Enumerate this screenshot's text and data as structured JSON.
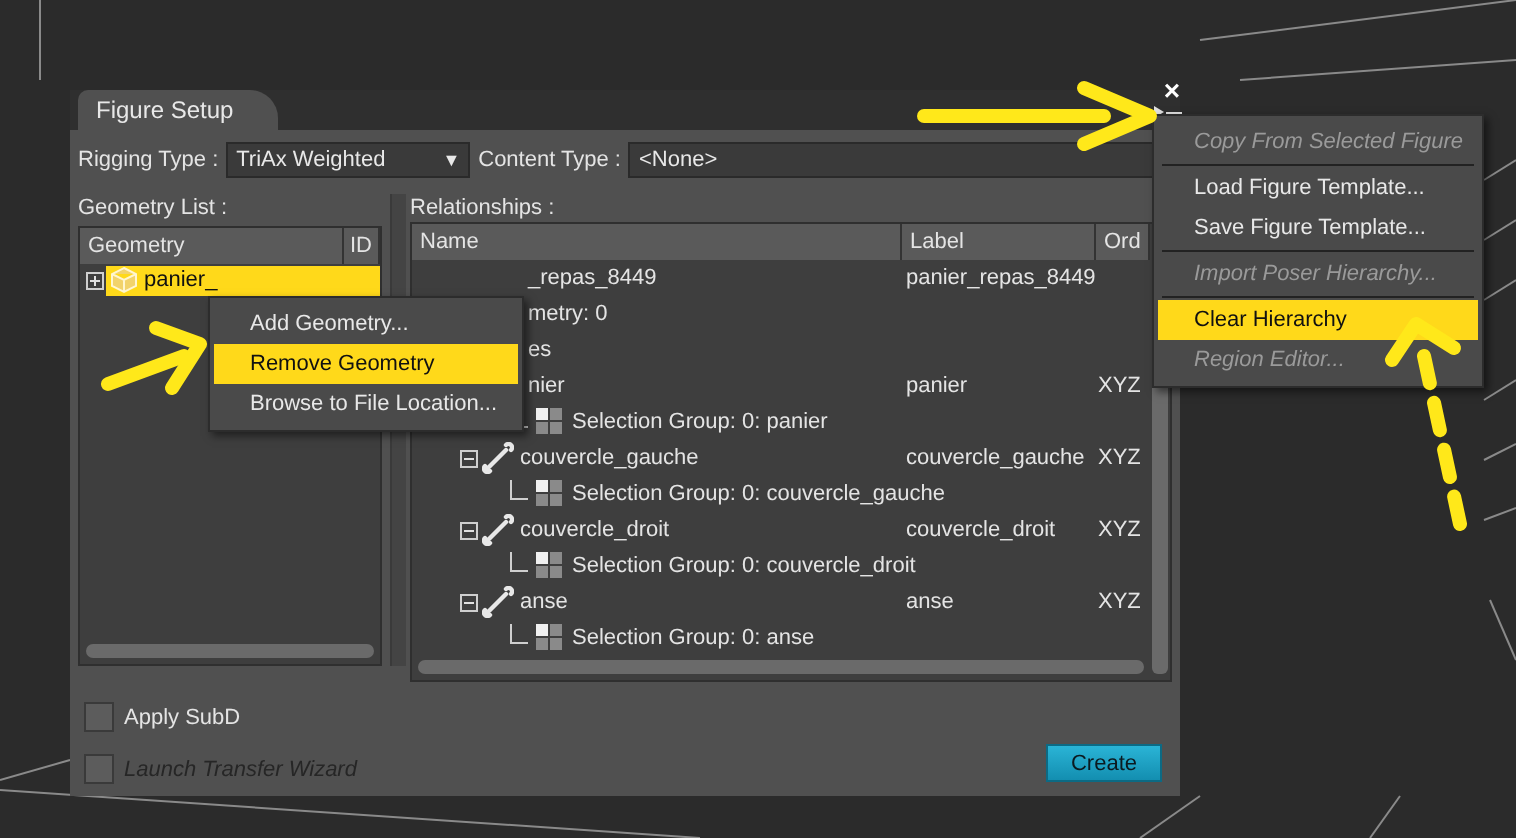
{
  "dialog": {
    "tab": "Figure Setup",
    "close": "×",
    "rigging_type": {
      "label": "Rigging Type :",
      "value": "TriAx Weighted",
      "arrow": "▼"
    },
    "content_type": {
      "label": "Content Type :",
      "value": "<None>"
    },
    "geometry_list": {
      "label": "Geometry List :",
      "columns": [
        "Geometry",
        "ID"
      ],
      "rows": [
        {
          "name": "panier_",
          "selected": true,
          "expanded": false
        }
      ]
    },
    "relationships": {
      "label": "Relationships :",
      "columns": [
        "Name",
        "Label",
        "Ord"
      ],
      "tree": [
        {
          "name": "_repas_8449",
          "label": "panier_repas_8449",
          "clipped": true,
          "children": [
            {
              "name": "metry: 0",
              "clipped": true
            },
            {
              "name": "es",
              "clipped": true,
              "children": [
                {
                  "name": "nier",
                  "label": "panier",
                  "order": "XYZ",
                  "clipped": true,
                  "children": [
                    {
                      "name": "Selection Group: 0: panier",
                      "kind": "selection",
                      "clipped": false
                    }
                  ]
                },
                {
                  "name": "couvercle_gauche",
                  "label": "couvercle_gauche",
                  "order": "XYZ",
                  "kind": "bone",
                  "clipped": false,
                  "expanded": true,
                  "children": [
                    {
                      "name": "Selection Group: 0: couvercle_gauche",
                      "kind": "selection",
                      "clipped": false
                    }
                  ]
                },
                {
                  "name": "couvercle_droit",
                  "label": "couvercle_droit",
                  "order": "XYZ",
                  "kind": "bone",
                  "clipped": false,
                  "expanded": true,
                  "children": [
                    {
                      "name": "Selection Group: 0: couvercle_droit",
                      "kind": "selection",
                      "clipped": false
                    }
                  ]
                },
                {
                  "name": "anse",
                  "label": "anse",
                  "order": "XYZ",
                  "kind": "bone",
                  "clipped": false,
                  "expanded": true,
                  "children": [
                    {
                      "name": "Selection Group: 0: anse",
                      "kind": "selection",
                      "clipped": false
                    }
                  ]
                }
              ]
            }
          ]
        }
      ]
    },
    "checkboxes": [
      {
        "label": "Apply SubD",
        "checked": false,
        "disabled": false
      },
      {
        "label": "Launch Transfer Wizard",
        "checked": false,
        "disabled": true
      }
    ],
    "create_button": "Create"
  },
  "geometry_menu": {
    "items": [
      {
        "label": "Add Geometry...",
        "selected": false
      },
      {
        "label": "Remove Geometry",
        "selected": true
      },
      {
        "label": "Browse to File Location...",
        "selected": false
      }
    ]
  },
  "options_menu": {
    "items": [
      {
        "label": "Copy From Selected Figure",
        "disabled": true,
        "selected": false,
        "separator_after": true
      },
      {
        "label": "Load Figure Template...",
        "disabled": false,
        "selected": false,
        "separator_after": false
      },
      {
        "label": "Save Figure Template...",
        "disabled": false,
        "selected": false,
        "separator_after": true
      },
      {
        "label": "Import Poser Hierarchy...",
        "disabled": true,
        "selected": false,
        "separator_after": true
      },
      {
        "label": "Clear Hierarchy",
        "disabled": false,
        "selected": true,
        "separator_after": false
      },
      {
        "label": "Region Editor...",
        "disabled": true,
        "selected": false,
        "separator_after": false
      }
    ]
  }
}
